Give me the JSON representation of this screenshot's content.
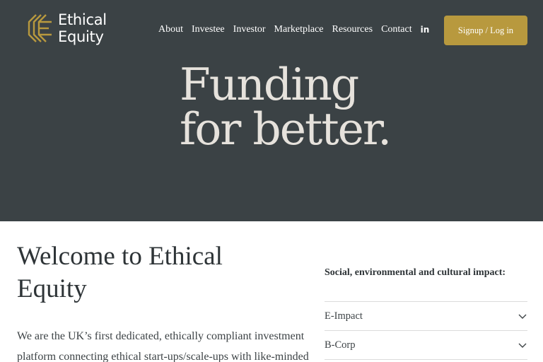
{
  "brand": {
    "line1": "Ethical",
    "line2": "Equity",
    "gold": "#b8993e",
    "dark": "#3b4245"
  },
  "nav": {
    "items": [
      "About",
      "Investee",
      "Investor",
      "Marketplace",
      "Resources",
      "Contact"
    ],
    "social_icon": "linkedin-icon",
    "social_text": "in",
    "cta": "Signup / Log in"
  },
  "hero": {
    "line1": "Funding",
    "line2": "for better."
  },
  "welcome": {
    "title": "Welcome to Ethical Equity",
    "intro": "We are the UK’s first dedicated, ethically compliant investment platform connecting ethical start-ups/scale-ups with like-minded"
  },
  "impact": {
    "heading": "Social, environmental and cultural impact:",
    "items": [
      "E-Impact",
      "B-Corp"
    ],
    "chevron_icon": "chevron-down-icon"
  }
}
